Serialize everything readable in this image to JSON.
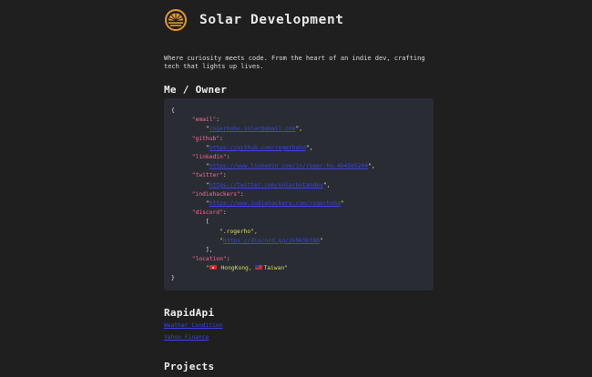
{
  "site": {
    "title": "Solar Development"
  },
  "tagline": "Where curiosity meets code. From the heart of an indie dev, crafting tech that lights up lives.",
  "sections": {
    "owner_heading": "Me / Owner",
    "rapidapi_heading": "RapidApi",
    "projects_heading": "Projects"
  },
  "owner_json": {
    "open_brace": "{",
    "close_brace": "}",
    "email": {
      "key": "\"email\"",
      "value": "rogerhoho.solar@gmail.com"
    },
    "github": {
      "key": "\"github\"",
      "value": "https://github.com/rogerhoho"
    },
    "linkedin": {
      "key": "\"linkedin\"",
      "value": "https://www.linkedin.com/in/roger-ho-4b45b5204"
    },
    "twitter": {
      "key": "\"twitter\"",
      "value": "https://twitter.com/solarbotandev"
    },
    "indiehackers": {
      "key": "\"indiehackers\"",
      "value": "https://www.indiehackers.com/rogerhoho"
    },
    "discord": {
      "key": "\"discord\"",
      "handle": ".rogerho",
      "value": "https://discord.gg/zk9k5bt8D"
    },
    "location": {
      "key": "\"location\"",
      "value_a": "HongKong, ",
      "value_b": "Taiwan"
    }
  },
  "rapidapi": {
    "links": [
      "Weather Condition",
      "Yahoo Finance"
    ]
  }
}
